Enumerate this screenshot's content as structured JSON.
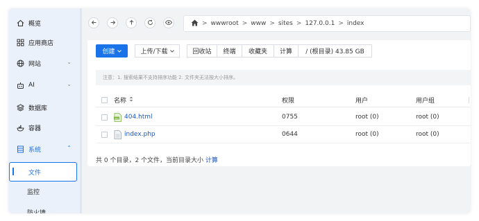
{
  "sidebar": {
    "items": [
      {
        "label": "概览",
        "icon": "home-icon"
      },
      {
        "label": "应用商店",
        "icon": "apps-grid-icon"
      },
      {
        "label": "网站",
        "icon": "globe-icon",
        "chevron": "⌄"
      },
      {
        "label": "AI",
        "icon": "robot-icon",
        "chevron": "⌄"
      },
      {
        "label": "数据库",
        "icon": "database-icon"
      },
      {
        "label": "容器",
        "icon": "docker-icon"
      },
      {
        "label": "系统",
        "icon": "system-icon",
        "chevron": "⌃"
      }
    ],
    "subitems": [
      {
        "label": "文件",
        "active": true
      },
      {
        "label": "监控",
        "active": false
      },
      {
        "label": "防火墙",
        "active": false
      }
    ]
  },
  "toolbar": {
    "nav_buttons": [
      "back",
      "forward",
      "up",
      "refresh",
      "view"
    ],
    "path": [
      "wwwroot",
      "www",
      "sites",
      "127.0.0.1",
      "index"
    ],
    "path_separator": ">"
  },
  "actions": {
    "create": "创建",
    "upload_download": "上传/下载",
    "recycle": "回收站",
    "terminal": "终端",
    "favorites": "收藏夹",
    "calculate": "计算",
    "disk": "/ (根目录) 43.85 GB"
  },
  "notice": "注意：1. 搜索结果不支持排序功能 2. 文件夹无法按大小排序。",
  "table": {
    "headers": {
      "name": "名称",
      "perm": "权限",
      "user": "用户",
      "group": "用户组"
    },
    "rows": [
      {
        "name": "404.html",
        "perm": "0755",
        "user": "root (0)",
        "group": "root (0)",
        "type": "html"
      },
      {
        "name": "index.php",
        "perm": "0644",
        "user": "root (0)",
        "group": "root (0)",
        "type": "php"
      }
    ]
  },
  "summary": {
    "text": "共 0 个目录，2 个文件，当前目录大小",
    "link": "计算"
  },
  "colors": {
    "accent": "#1a73e8",
    "sidebar_bg": "#ebf1fb",
    "link": "#1a56c4"
  }
}
